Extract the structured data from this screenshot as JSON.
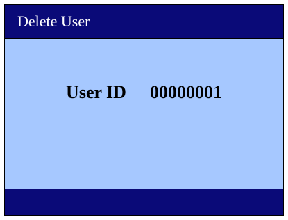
{
  "window": {
    "title": "Delete User"
  },
  "main": {
    "user_id_label": "User ID",
    "user_id_value": "00000001"
  },
  "colors": {
    "title_bar": "#0a0a78",
    "content_bg": "#a6c8ff",
    "footer_bar": "#0a0a78"
  }
}
